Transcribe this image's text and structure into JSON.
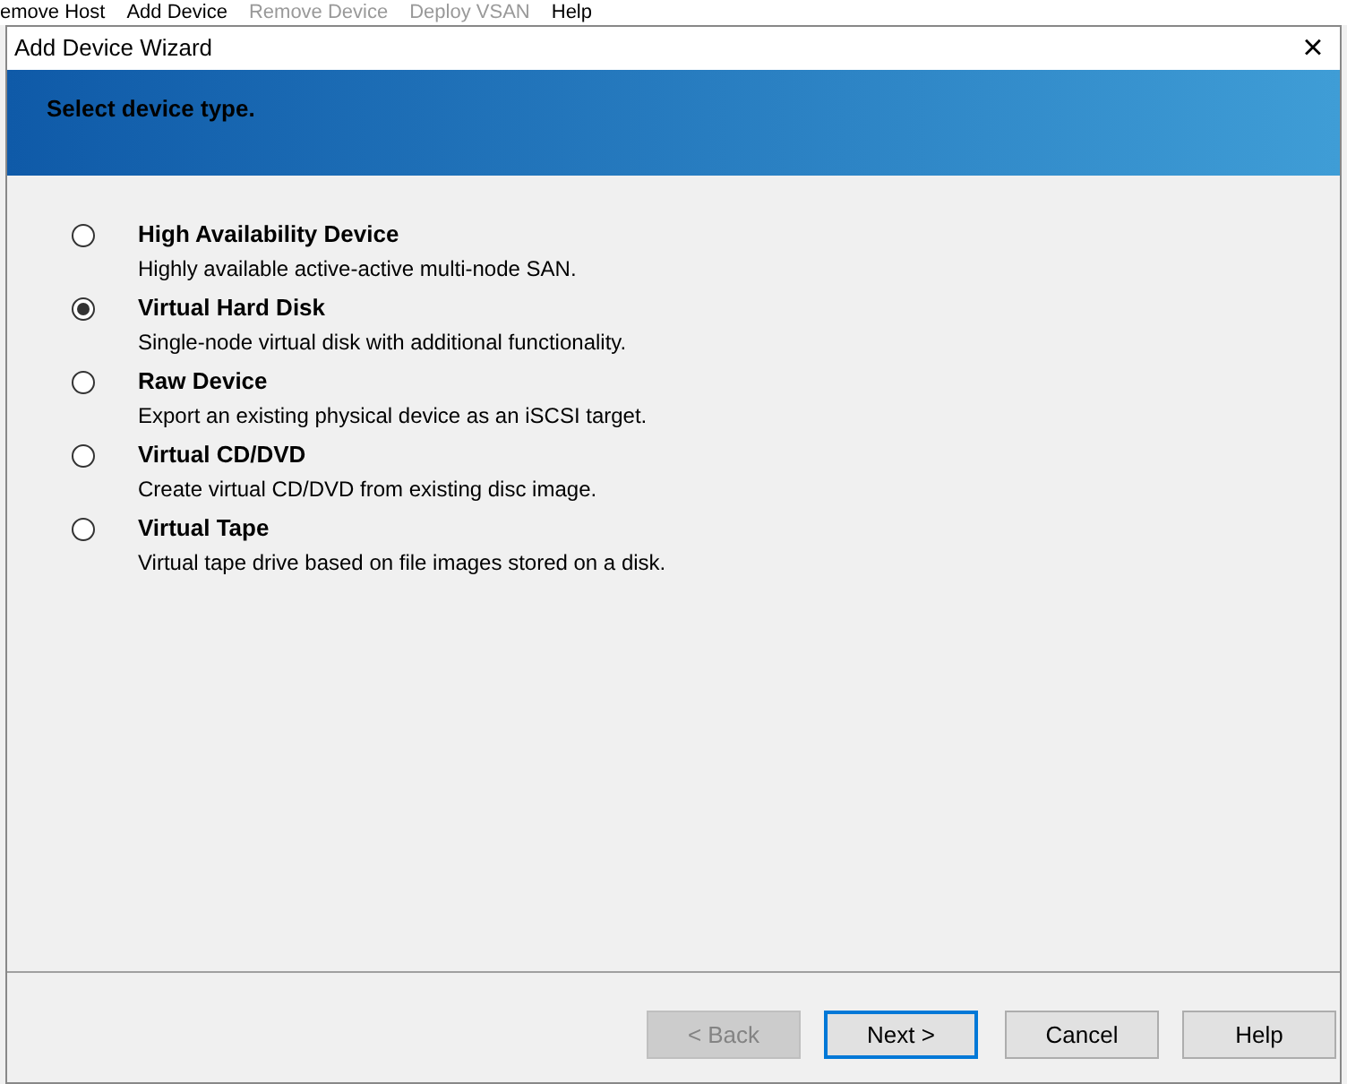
{
  "background_menu": [
    {
      "label": "emove Host",
      "disabled": false
    },
    {
      "label": "Add Device",
      "disabled": false
    },
    {
      "label": "Remove Device",
      "disabled": true
    },
    {
      "label": "Deploy VSAN",
      "disabled": true
    },
    {
      "label": "Help",
      "disabled": false
    }
  ],
  "window": {
    "title": "Add Device Wizard",
    "close": "×"
  },
  "header": {
    "title": "Select device type."
  },
  "options": [
    {
      "label": "High Availability Device",
      "description": "Highly available active-active multi-node SAN.",
      "selected": false
    },
    {
      "label": "Virtual Hard Disk",
      "description": "Single-node virtual disk with additional functionality.",
      "selected": true
    },
    {
      "label": "Raw Device",
      "description": "Export an existing physical device as an iSCSI target.",
      "selected": false
    },
    {
      "label": "Virtual CD/DVD",
      "description": "Create virtual CD/DVD from existing disc image.",
      "selected": false
    },
    {
      "label": "Virtual Tape",
      "description": "Virtual tape drive based on file images stored on a disk.",
      "selected": false
    }
  ],
  "buttons": [
    {
      "label": "< Back",
      "disabled": true,
      "focused": false
    },
    {
      "label": "Next >",
      "disabled": false,
      "focused": true
    },
    {
      "label": "Cancel",
      "disabled": false,
      "focused": false
    },
    {
      "label": "Help",
      "disabled": false,
      "focused": false
    }
  ]
}
